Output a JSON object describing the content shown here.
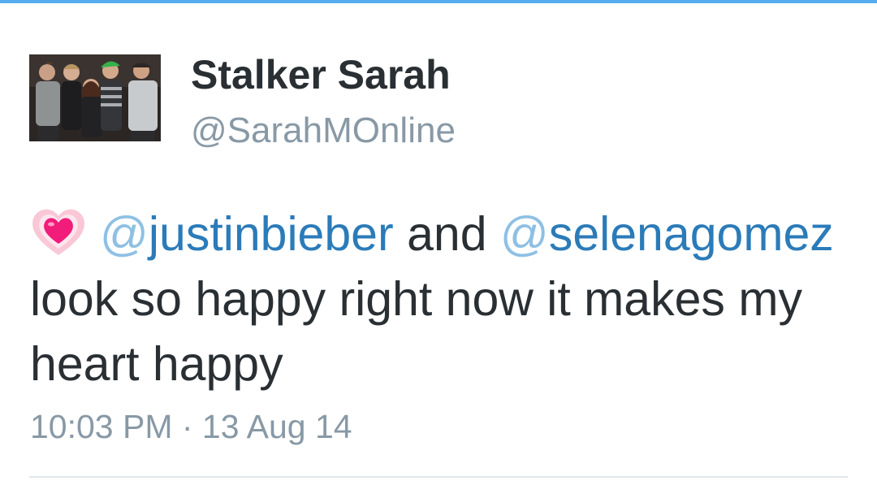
{
  "tweet": {
    "author": {
      "display_name": "Stalker Sarah",
      "handle": "@SarahMOnline",
      "avatar_icon": "group-photo-avatar"
    },
    "emoji": "growing-heart-emoji",
    "mention_1_at": "@",
    "mention_1_name": "justinbieber",
    "and_text": "and",
    "mention_2_at": "@",
    "mention_2_name": "selenagomez",
    "line_2": "look so happy right now it makes my",
    "line_3": "heart happy",
    "timestamp": "10:03 PM · 13 Aug 14"
  },
  "colors": {
    "accent_bar": "#55acee",
    "mention": "#2b7bb9",
    "text": "#292f33",
    "muted": "#8899a6"
  }
}
